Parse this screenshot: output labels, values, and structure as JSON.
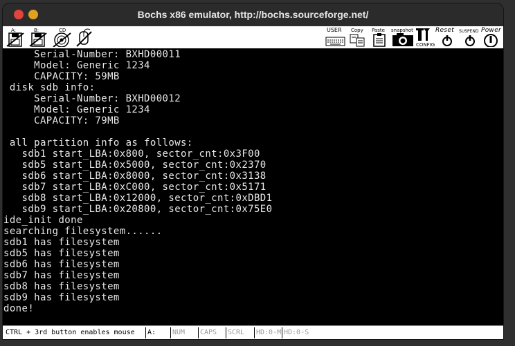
{
  "window": {
    "title": "Bochs x86 emulator, http://bochs.sourceforge.net/"
  },
  "toolbar": {
    "floppy_a_label": "A:",
    "floppy_b_label": "B:",
    "cdrom_label": "CD",
    "user_label": "USER",
    "copy_label": "Copy",
    "paste_label": "Paste",
    "snapshot_label": "snapshot",
    "config_label": "CONFIG",
    "reset_label": "Reset",
    "suspend_label": "SUSPEND",
    "power_label": "Power"
  },
  "console": {
    "lines": [
      "     Serial-Number: BXHD00011",
      "     Model: Generic 1234",
      "     CAPACITY: 59MB",
      " disk sdb info:",
      "     Serial-Number: BXHD00012",
      "     Model: Generic 1234",
      "     CAPACITY: 79MB",
      "",
      " all partition info as follows:",
      "   sdb1 start_LBA:0x800, sector_cnt:0x3F00",
      "   sdb5 start_LBA:0x5000, sector_cnt:0x2370",
      "   sdb6 start_LBA:0x8000, sector_cnt:0x3138",
      "   sdb7 start_LBA:0xC000, sector_cnt:0x5171",
      "   sdb8 start_LBA:0x12000, sector_cnt:0xDBD1",
      "   sdb9 start_LBA:0x20800, sector_cnt:0x75E0",
      "ide_init done",
      "searching filesystem......",
      "sdb1 has filesystem",
      "sdb5 has filesystem",
      "sdb6 has filesystem",
      "sdb7 has filesystem",
      "sdb8 has filesystem",
      "sdb9 has filesystem",
      "done!"
    ]
  },
  "statusbar": {
    "message": "CTRL + 3rd button enables mouse",
    "drive": "A:",
    "num": "NUM",
    "caps": "CAPS",
    "scrl": "SCRL",
    "hd0m": "HD:0-M",
    "hd0s": "HD:0-S"
  }
}
